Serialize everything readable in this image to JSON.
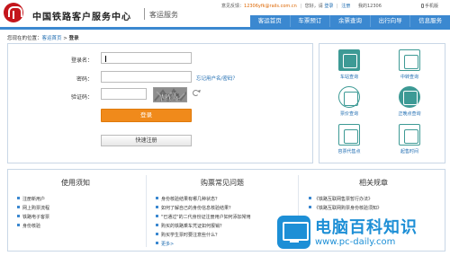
{
  "header": {
    "site_title": "中国铁路客户服务中心",
    "site_sub": "客运服务",
    "feedback_label": "意见反馈：",
    "feedback_email": "12306yfk@rails.com.cn",
    "greeting": "您好，请",
    "login_link": "登录",
    "register_link": "注册",
    "hotline": "我的12306",
    "mobile": "手机版",
    "brand_color": "#3b88d0"
  },
  "nav": [
    "客运首页",
    "车票预订",
    "余票查询",
    "出行向导",
    "信息服务"
  ],
  "breadcrumb": {
    "prefix": "您现在的位置：",
    "home": "客运首页",
    "sep": ">",
    "current": "登录"
  },
  "login": {
    "username_label": "登录名：",
    "password_label": "密码：",
    "captcha_label": "验证码：",
    "captcha_text": "pyk",
    "forgot_link": "忘记用户名/密码？",
    "login_button": "登录",
    "register_button": "快速注册",
    "button_color": "#f08a1b"
  },
  "services": [
    {
      "label": "车站查询",
      "icon": "station-icon"
    },
    {
      "label": "中转查询",
      "icon": "transfer-icon"
    },
    {
      "label": "票价查询",
      "icon": "fare-search-icon"
    },
    {
      "label": "正晚点查询",
      "icon": "delay-search-icon"
    },
    {
      "label": "容票代售点",
      "icon": "agency-icon"
    },
    {
      "label": "起售时间",
      "icon": "clock-icon"
    }
  ],
  "columns": {
    "usage": {
      "title": "使用须知",
      "items": [
        "注册新用户",
        "网上购票流程",
        "铁路电子客票",
        "身份核验"
      ]
    },
    "faq": {
      "title": "购票常见问题",
      "items": [
        "身份核验结果有哪几种状态？",
        "如何了解自己的身份信息核验结果？",
        "\"已通过\"的二代身份证注册用户如何添加常用",
        "购买的铁路乘车凭证如何报销？",
        "购买学生票时要注意些什么？"
      ],
      "more": "更多>"
    },
    "rules": {
      "title": "相关规章",
      "items": [
        "《铁路互联网售票暂行办法》",
        "《铁路互联网购票身份核验须知》"
      ]
    }
  },
  "watermark": {
    "title": "电脑百科知识",
    "url": "www.pc-daily.com"
  }
}
